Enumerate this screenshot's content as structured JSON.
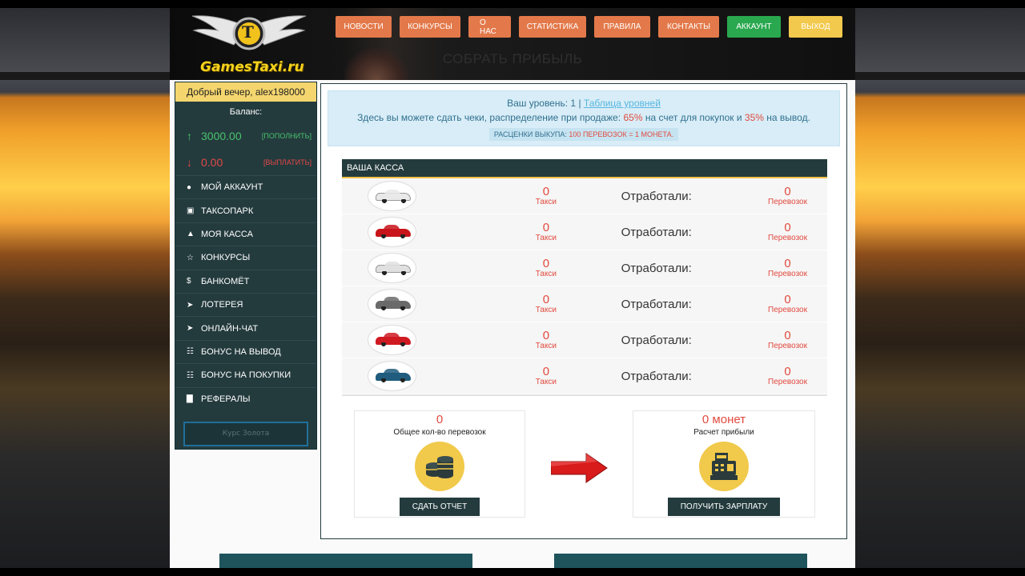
{
  "header": {
    "logo_text": "GamesTaxi.ru",
    "logo_letter": "T",
    "page_heading": "СОБРАТЬ ПРИБЫЛЬ"
  },
  "nav": {
    "items": [
      {
        "label": "НОВОСТИ"
      },
      {
        "label": "КОНКУРСЫ"
      },
      {
        "label": "О НАС"
      },
      {
        "label": "СТАТИСТИКА"
      },
      {
        "label": "ПРАВИЛА"
      },
      {
        "label": "КОНТАКТЫ"
      },
      {
        "label": "АККАУНТ"
      },
      {
        "label": "ВЫХОД"
      }
    ]
  },
  "sidebar": {
    "greeting": "Добрый вечер, alex198000",
    "balance_title": "Баланс:",
    "balance_in": {
      "value": "3000.00",
      "link": "[ПОПОЛНИТЬ]"
    },
    "balance_out": {
      "value": "0.00",
      "link": "[ВЫПЛАТИТЬ]"
    },
    "menu": [
      {
        "label": "МОЙ АККАУНТ",
        "icon": "user-icon"
      },
      {
        "label": "ТАКСОПАРК",
        "icon": "briefcase-icon"
      },
      {
        "label": "МОЯ КАССА",
        "icon": "road-icon"
      },
      {
        "label": "КОНКУРСЫ",
        "icon": "star-icon"
      },
      {
        "label": "БАНКОМЁТ",
        "icon": "dollar-icon"
      },
      {
        "label": "ЛОТЕРЕЯ",
        "icon": "send-icon"
      },
      {
        "label": "ОНЛАЙН-ЧАТ",
        "icon": "send-icon"
      },
      {
        "label": "БОНУС НА ВЫВОД",
        "icon": "grid-icon"
      },
      {
        "label": "БОНУС НА ПОКУПКИ",
        "icon": "grid-icon"
      },
      {
        "label": "РЕФЕРАЛЫ",
        "icon": "bar-chart-icon"
      }
    ],
    "input_placeholder": "Курс Золота"
  },
  "info": {
    "level_label": "Ваш уровень:",
    "level_value": "1",
    "level_sep": "|",
    "level_table_link": "Таблица уровней",
    "line2_a": "Здесь вы можете сдать чеки, распределение при продаже:",
    "line2_pct1": "65%",
    "line2_b": "на счет для покупок и",
    "line2_pct2": "35%",
    "line2_c": "на вывод.",
    "line3_a": "РАСЦЕНКИ ВЫКУПА:",
    "line3_b": "100 ПЕРЕВОЗОК = 1 МОНЕТА."
  },
  "kassa": {
    "title": "ВАША КАССА",
    "worked_label": "Отработали:",
    "taxi_label": "Такси",
    "trips_label": "Перевозок",
    "rows": [
      {
        "taxi": "0",
        "trips": "0",
        "car_color": "#e9e9e9"
      },
      {
        "taxi": "0",
        "trips": "0",
        "car_color": "#c8141a"
      },
      {
        "taxi": "0",
        "trips": "0",
        "car_color": "#e0e0e0"
      },
      {
        "taxi": "0",
        "trips": "0",
        "car_color": "#6a6a6a"
      },
      {
        "taxi": "0",
        "trips": "0",
        "car_color": "#d01a22"
      },
      {
        "taxi": "0",
        "trips": "0",
        "car_color": "#1f5c7d"
      }
    ]
  },
  "report": {
    "total": "0",
    "total_label": "Общее кол-во перевозок",
    "button": "СДАТЬ ОТЧЕТ"
  },
  "profit": {
    "value": "0 монет",
    "label": "Расчет прибыли",
    "button": "ПОЛУЧИТЬ ЗАРПЛАТУ"
  },
  "colors": {
    "nav_orange": "#e3794a",
    "nav_green": "#2aa84f",
    "nav_yellow": "#f2c94c",
    "sidebar_dark": "#243b3e",
    "accent_red": "#e14a3f",
    "accent_green": "#49c36c"
  }
}
